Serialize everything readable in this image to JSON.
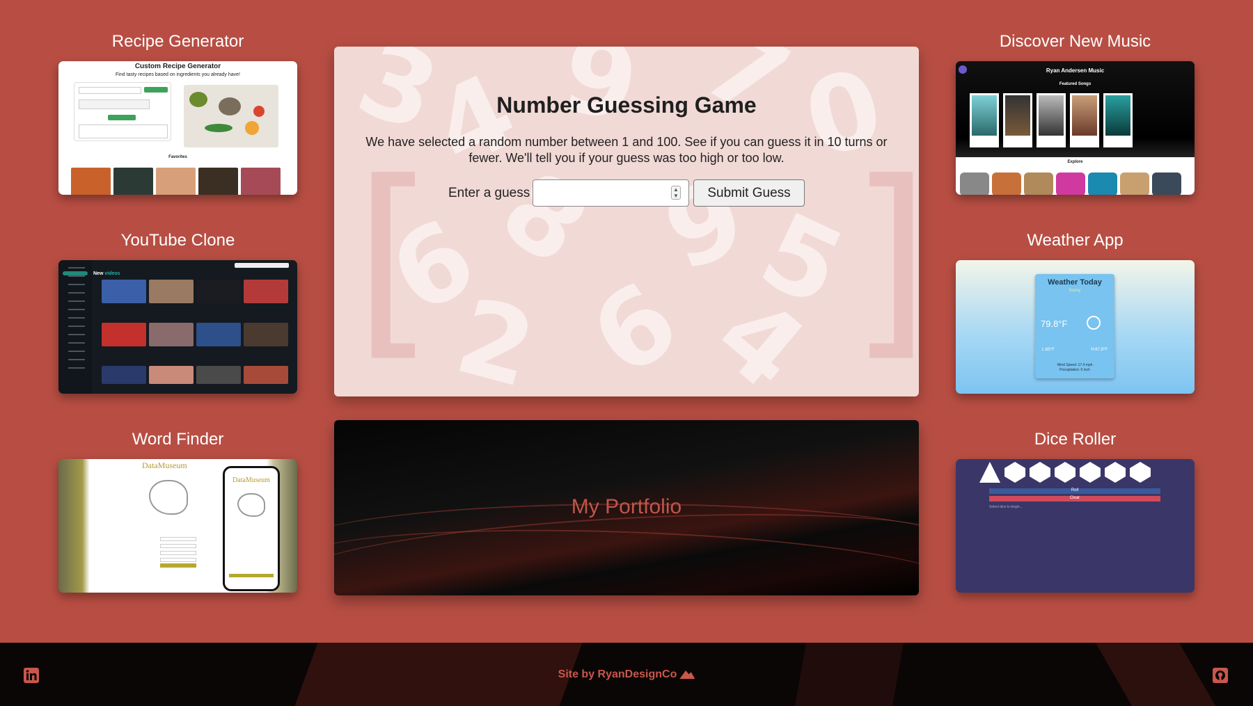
{
  "projects": {
    "recipe": {
      "title": "Recipe Generator",
      "heading": "Custom Recipe Generator",
      "sub": "Find tasty recipes based on ingredients you already have!",
      "favorites": "Favorites"
    },
    "youtube": {
      "title": "YouTube Clone",
      "new": "New",
      "videos": "videos"
    },
    "word": {
      "title": "Word Finder",
      "brand": "DataMuseum"
    },
    "music": {
      "title": "Discover New Music",
      "name": "Ryan Andersen Music",
      "featured": "Featured Songs",
      "explore": "Explore"
    },
    "weather": {
      "title": "Weather App",
      "heading": "Weather Today",
      "cond": "Sunny",
      "temp": "79.8°F",
      "low": "L:65°F",
      "high": "H:87.8°F",
      "wind": "Wind Speed: 17.4 mph",
      "precip": "Precipitation: 0 inch"
    },
    "dice": {
      "title": "Dice Roller",
      "roll": "Roll",
      "clear": "Clear",
      "select": "Select dice to begin..."
    }
  },
  "game": {
    "title": "Number Guessing Game",
    "description": "We have selected a random number between 1 and 100. See if you can guess it in 10 turns or fewer. We'll tell you if your guess was too high or too low.",
    "label": "Enter a guess",
    "input_value": "",
    "button": "Submit Guess",
    "bracket_left": "[",
    "bracket_right": "]"
  },
  "portfolio": {
    "label": "My Portfolio"
  },
  "footer": {
    "credit": "Site by RyanDesignCo",
    "linkedin_icon": "linkedin-icon",
    "github_icon": "github-icon"
  },
  "colors": {
    "background": "#b84e43",
    "accent": "#c9574b",
    "footer": "#0b0606"
  }
}
